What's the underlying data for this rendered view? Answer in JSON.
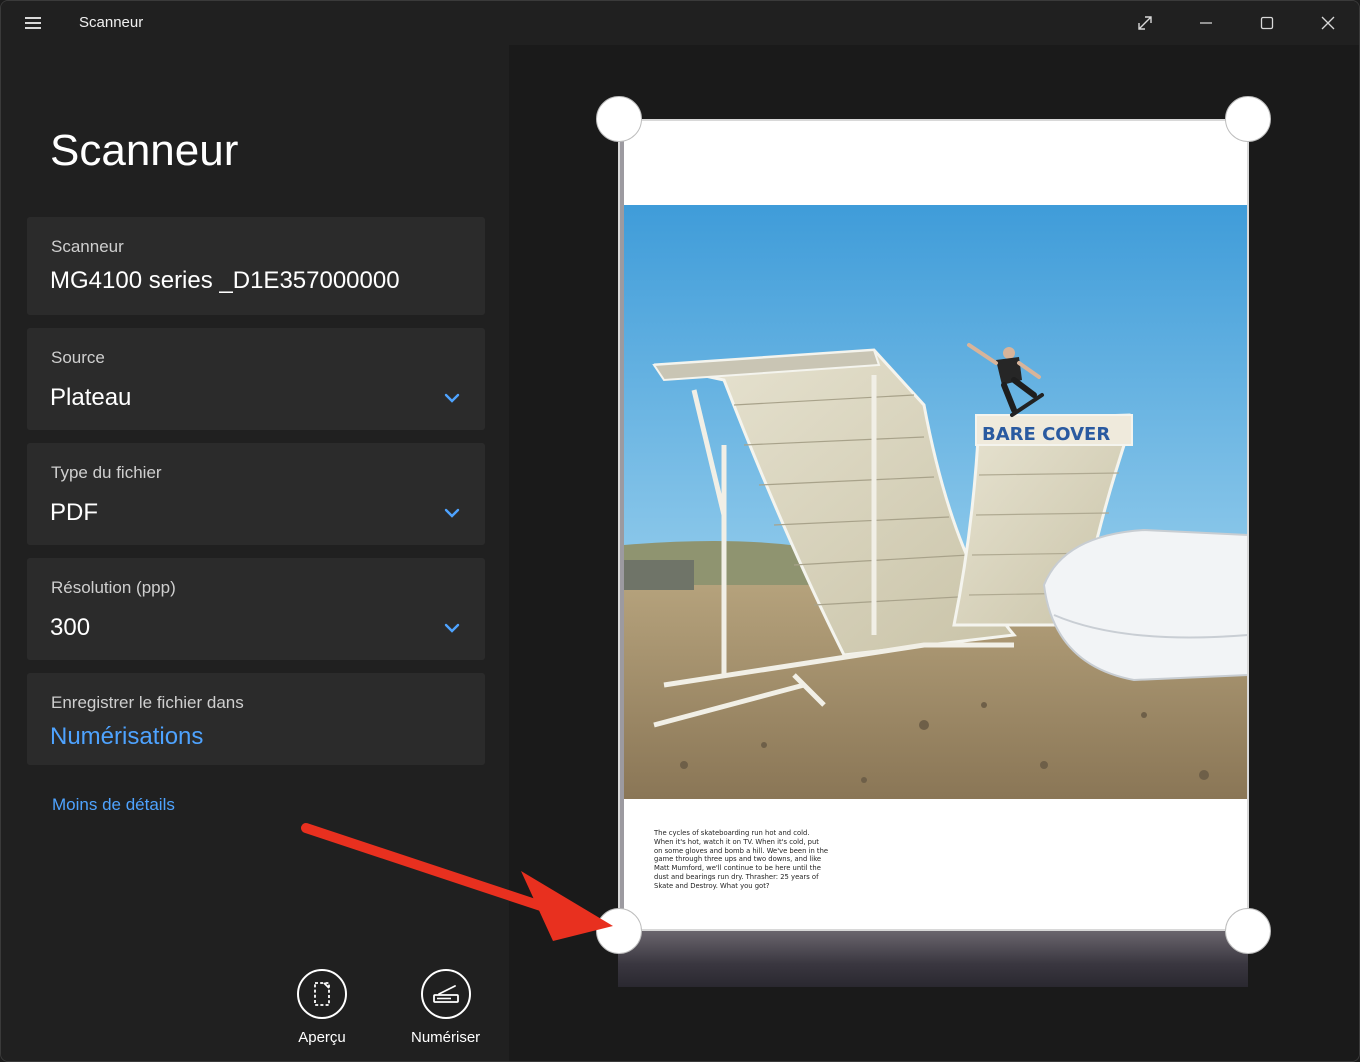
{
  "window": {
    "title": "Scanneur"
  },
  "titlebar": {
    "menu_icon": "hamburger-icon",
    "buttons": [
      "expand-icon",
      "minimize-icon",
      "maximize-icon",
      "close-icon"
    ]
  },
  "left_pane": {
    "title": "Scanneur",
    "scanner": {
      "label": "Scanneur",
      "value": "MG4100 series _D1E357000000"
    },
    "source": {
      "label": "Source",
      "value": "Plateau"
    },
    "file_type": {
      "label": "Type du fichier",
      "value": "PDF"
    },
    "resolution": {
      "label": "Résolution (ppp)",
      "value": "300"
    },
    "save_location": {
      "label": "Enregistrer le fichier dans",
      "value": "Numérisations"
    },
    "less_details": "Moins de détails",
    "actions": {
      "preview": "Aperçu",
      "scan": "Numériser"
    }
  },
  "preview": {
    "photo_sign": "BARE COVER",
    "caption_lines": [
      "The cycles of skateboarding run hot and cold.",
      "When it's hot, watch it on TV. When it's cold, put",
      "on some gloves and bomb a hill. We've been in the",
      "game through three ups and two downs, and like",
      "Matt Mumford, we'll continue to be here until the",
      "dust and bearings run dry. Thrasher: 25 years of",
      "Skate and Destroy. What you got?"
    ]
  },
  "colors": {
    "accent": "#4ea3ff",
    "panel": "#2b2b2b",
    "background": "#202020",
    "arrow": "#e8301f"
  }
}
